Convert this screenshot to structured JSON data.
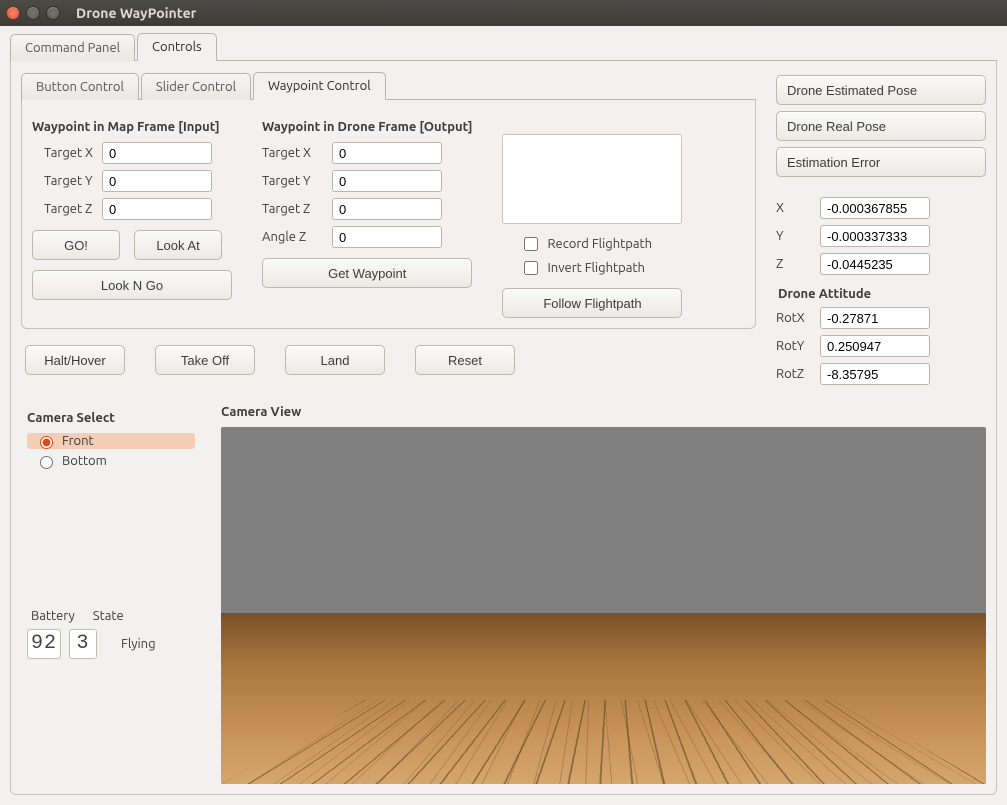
{
  "window": {
    "title": "Drone WayPointer"
  },
  "outer_tabs": [
    {
      "label": "Command Panel"
    },
    {
      "label": "Controls"
    }
  ],
  "inner_tabs": [
    {
      "label": "Button Control"
    },
    {
      "label": "Slider Control"
    },
    {
      "label": "Waypoint Control"
    }
  ],
  "waypoint_input": {
    "title": "Waypoint in Map Frame [Input]",
    "target_x_label": "Target X",
    "target_y_label": "Target Y",
    "target_z_label": "Target Z",
    "target_x": "0",
    "target_y": "0",
    "target_z": "0",
    "go": "GO!",
    "look_at": "Look At",
    "look_n_go": "Look N Go"
  },
  "waypoint_output": {
    "title": "Waypoint in Drone Frame [Output]",
    "target_x_label": "Target X",
    "target_y_label": "Target Y",
    "target_z_label": "Target Z",
    "angle_z_label": "Angle Z",
    "target_x": "0",
    "target_y": "0",
    "target_z": "0",
    "angle_z": "0",
    "get_waypoint": "Get Waypoint"
  },
  "flightpath": {
    "record_label": "Record Flightpath",
    "invert_label": "Invert Flightpath",
    "follow": "Follow Flightpath"
  },
  "action_buttons": {
    "halt": "Halt/Hover",
    "takeoff": "Take Off",
    "land": "Land",
    "reset": "Reset"
  },
  "camera": {
    "select_title": "Camera Select",
    "front": "Front",
    "bottom": "Bottom",
    "view_title": "Camera View"
  },
  "status": {
    "battery_label": "Battery",
    "state_label": "State",
    "battery": "92",
    "state": "3",
    "state_text": "Flying"
  },
  "pose": {
    "est_btn": "Drone Estimated Pose",
    "real_btn": "Drone Real Pose",
    "err_btn": "Estimation Error",
    "x_label": "X",
    "y_label": "Y",
    "z_label": "Z",
    "x": "-0.000367855",
    "y": "-0.000337333",
    "z": "-0.0445235",
    "attitude_title": "Drone Attitude",
    "rotx_label": "RotX",
    "roty_label": "RotY",
    "rotz_label": "RotZ",
    "rotx": "-0.27871",
    "roty": "0.250947",
    "rotz": "-8.35795"
  }
}
